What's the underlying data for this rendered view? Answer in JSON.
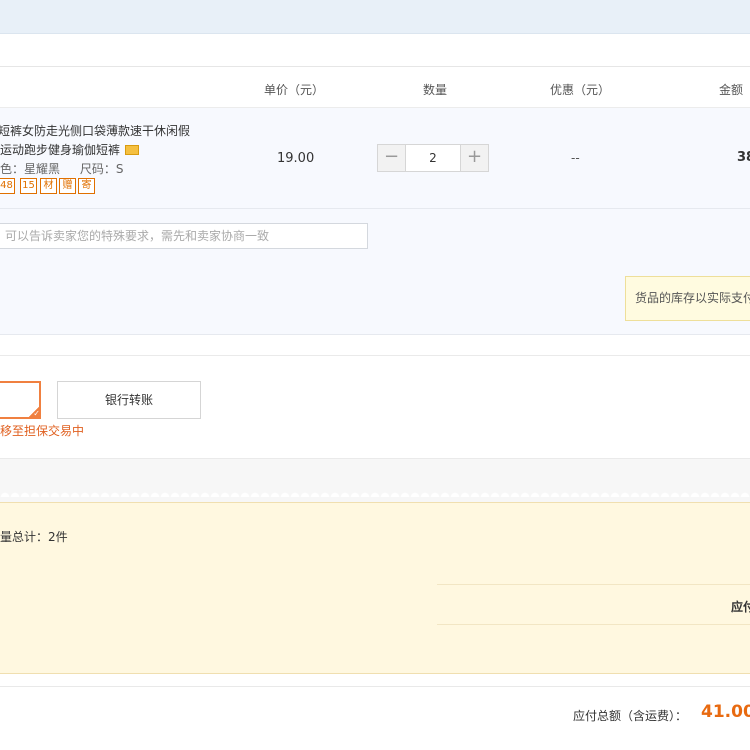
{
  "table_header": {
    "unit_price": "单价（元）",
    "quantity": "数量",
    "discount": "优惠（元）",
    "amount": "金额（"
  },
  "item": {
    "title_line1": "短裤女防走光侧口袋薄款速干休闲假",
    "title_line2": "运动跑步健身瑜伽短裤",
    "sku_color": "色：星耀黑",
    "sku_size": "尺码：S",
    "badges": [
      "48",
      "15",
      "材",
      "赠",
      "寄"
    ],
    "price": "19.00",
    "quantity": "2",
    "qty_minus": "−",
    "qty_plus": "+",
    "discount": "--",
    "amount": "38"
  },
  "message": {
    "placeholder": "可以告诉卖家您的特殊要求，需先和卖家协商一致"
  },
  "notice": {
    "text": "货品的库存以实际支付"
  },
  "payment": {
    "bank_transfer": "银行转账",
    "note": "移至担保交易中"
  },
  "summary": {
    "count_text": "量总计：2件",
    "payable_label": "应付"
  },
  "total": {
    "label": "应付总额（含运费）：",
    "value": "41.00"
  },
  "colors": {
    "accent_orange": "#e86a10",
    "top_band": "#e8f0f8",
    "summary_bg": "#fff8e0"
  }
}
